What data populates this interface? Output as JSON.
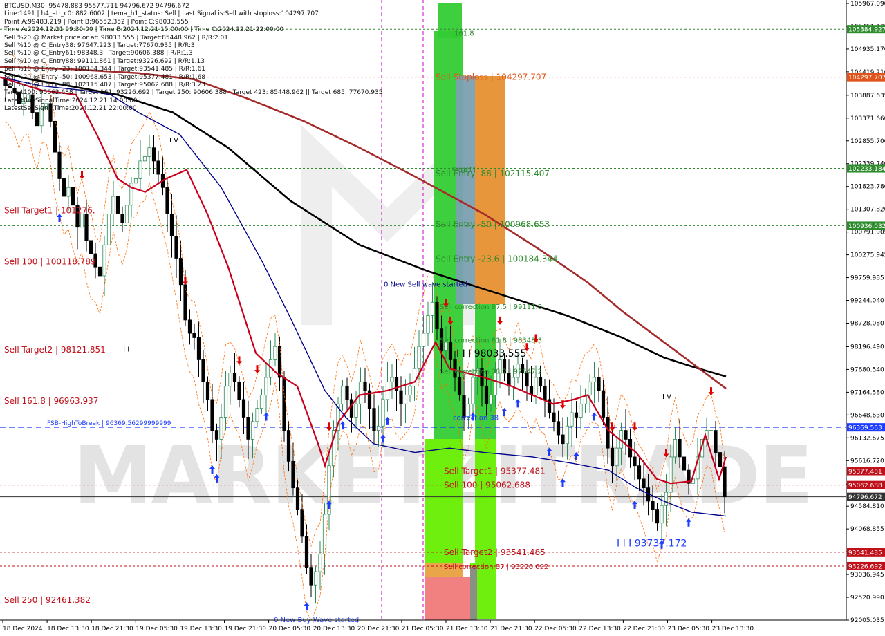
{
  "window": {
    "title": "BTCUSD,M30"
  },
  "info_lines": [
    "BTCUSD,M30  95478.883 95577.711 94796.672 94796.672",
    "Line:1491 | h4_atr_c0: 882.6002 | tema_h1_status: Sell | Last Signal is:Sell with stoploss:104297.707",
    "Point A:99483.219 | Point B:96552.352 | Point C:98033.555",
    "Time A:2024.12.21 09:30:00 | Time B:2024.12.21 15:00:00 | Time C:2024.12.21 22:00:00",
    "Sell %20 @ Market price or at: 98033.555 | Target:85448.962 | R/R:2.01",
    "Sell %10 @ C_Entry38: 97647.223 | Target:77670.935 | R/R:3",
    "Sell %10 @ C_Entry61: 98348.3 | Target:90606.388 | R/R:1.3",
    "Sell %10 @ C_Entry88: 99111.861 | Target:93226.692 | R/R:1.13",
    "Sell %10 @ Entry -23: 100184.344 | Target:93541.485 | R/R:1.61",
    "Sell %20 @ Entry -50: 100968.653 | Target:95377.481 | R/R:1.68",
    "Sell %20 @ Entry -88: 102115.407 | Target:95062.688 | R/R:3.23",
    "Target100: 95062.688 | Target 161: 93226.692 | Target 250: 90606.388 | Target 423: 85448.962 || Target 685: 77670.935",
    "LatestBuySignalTime:2024.12.21 14:00:00",
    "LatestSellSignalTime:2024.12.21 22:00:00"
  ],
  "chart_data": {
    "type": "candlestick",
    "symbol": "BTCUSD",
    "timeframe": "M30",
    "ylim": [
      92005.035,
      105967.09
    ],
    "y_ticks": [
      "105967.090",
      "105451.130",
      "104935.170",
      "104419.210",
      "103887.635",
      "103371.660",
      "102855.700",
      "102339.740",
      "101823.780",
      "101307.820",
      "100791.905",
      "100275.945",
      "99759.985",
      "99244.040",
      "98728.080",
      "98196.490",
      "97680.540",
      "97164.580",
      "96648.630",
      "96132.675",
      "95616.720",
      "95084.780",
      "94584.810",
      "94068.855",
      "93552.900",
      "93036.945",
      "92520.990",
      "92005.035"
    ],
    "x_ticks": [
      "18 Dec 2024",
      "18 Dec 13:30",
      "18 Dec 21:30",
      "19 Dec 05:30",
      "19 Dec 13:30",
      "19 Dec 21:30",
      "20 Dec 05:30",
      "20 Dec 13:30",
      "20 Dec 21:30",
      "21 Dec 05:30",
      "21 Dec 13:30",
      "21 Dec 21:30",
      "22 Dec 05:30",
      "22 Dec 13:30",
      "22 Dec 21:30",
      "23 Dec 05:30",
      "23 Dec 13:30"
    ],
    "close": [
      104100,
      104050,
      103950,
      103700,
      103750,
      103900,
      103500,
      103200,
      103600,
      103700,
      103300,
      102600,
      102000,
      101600,
      101800,
      101400,
      100900,
      101200,
      100600,
      100300,
      100000,
      99800,
      100500,
      101200,
      101600,
      101200,
      101000,
      101400,
      101900,
      102000,
      102400,
      102500,
      102700,
      102400,
      102100,
      101800,
      101200,
      100700,
      100200,
      99600,
      98800,
      98500,
      98400,
      97900,
      97400,
      97000,
      96300,
      96100,
      96600,
      97300,
      97600,
      97400,
      97000,
      96600,
      96100,
      96500,
      96800,
      97100,
      97500,
      97900,
      98200,
      97500,
      96300,
      95600,
      95000,
      94500,
      93900,
      93200,
      92800,
      93100,
      93500,
      94400,
      95500,
      96300,
      96900,
      97300,
      97000,
      96600,
      96900,
      97400,
      97200,
      96800,
      96300,
      96400,
      97000,
      97400,
      97500,
      97200,
      96900,
      97100,
      97300,
      97700,
      98200,
      98500,
      98900,
      99200,
      98600,
      98100,
      98300,
      97900,
      97500,
      97100,
      96600,
      96900,
      97500,
      97700,
      97300,
      96900,
      97100,
      97600,
      97900,
      97600,
      97300,
      97500,
      97800,
      97600,
      97300,
      97100,
      97500,
      97300,
      97000,
      96700,
      96500,
      96200,
      96000,
      96400,
      96700,
      96600,
      96900,
      97100,
      97400,
      97500,
      97200,
      96600,
      95900,
      95500,
      95900,
      96300,
      96100,
      95700,
      95500,
      95200,
      95000,
      94700,
      94500,
      94200,
      94600,
      94900,
      95700,
      96100,
      95700,
      95400,
      95100,
      95200,
      95700,
      96100,
      96300,
      96300,
      95800,
      95478,
      94796
    ],
    "overlay_lines": [
      {
        "name": "ma-black",
        "color": "#000000",
        "values": [
          [
            0,
            104420
          ],
          [
            40,
            104260
          ],
          [
            100,
            104100
          ],
          [
            170,
            103900
          ],
          [
            250,
            103500
          ],
          [
            330,
            102700
          ],
          [
            420,
            101500
          ],
          [
            520,
            100500
          ],
          [
            620,
            99900
          ],
          [
            720,
            99400
          ],
          [
            820,
            98900
          ],
          [
            900,
            98400
          ],
          [
            960,
            97950
          ],
          [
            1000,
            97750
          ],
          [
            1050,
            97520
          ]
        ]
      },
      {
        "name": "ma-brown",
        "color": "#a52a2a",
        "values": [
          [
            0,
            104530
          ],
          [
            100,
            104480
          ],
          [
            200,
            104390
          ],
          [
            280,
            104250
          ],
          [
            360,
            103800
          ],
          [
            440,
            103300
          ],
          [
            520,
            102700
          ],
          [
            600,
            102050
          ],
          [
            700,
            101200
          ],
          [
            780,
            100400
          ],
          [
            850,
            99650
          ],
          [
            900,
            99000
          ],
          [
            960,
            98300
          ],
          [
            1050,
            97250
          ]
        ]
      },
      {
        "name": "ma-navy",
        "color": "#00008b",
        "values": [
          [
            0,
            104300
          ],
          [
            60,
            104100
          ],
          [
            120,
            104000
          ],
          [
            160,
            103900
          ],
          [
            200,
            103500
          ],
          [
            260,
            103000
          ],
          [
            320,
            101800
          ],
          [
            380,
            100100
          ],
          [
            420,
            98850
          ],
          [
            470,
            97200
          ],
          [
            500,
            96600
          ],
          [
            540,
            96000
          ],
          [
            600,
            95800
          ],
          [
            650,
            95900
          ],
          [
            700,
            95800
          ],
          [
            770,
            95700
          ],
          [
            830,
            95550
          ],
          [
            880,
            95400
          ],
          [
            920,
            95000
          ],
          [
            960,
            94700
          ],
          [
            1000,
            94450
          ],
          [
            1050,
            94360
          ]
        ]
      },
      {
        "name": "tema-red",
        "color": "#c8001e",
        "values": [
          [
            0,
            104300
          ],
          [
            60,
            104000
          ],
          [
            110,
            103900
          ],
          [
            140,
            103000
          ],
          [
            170,
            102000
          ],
          [
            190,
            101800
          ],
          [
            210,
            101700
          ],
          [
            240,
            102000
          ],
          [
            270,
            102200
          ],
          [
            300,
            101200
          ],
          [
            330,
            100000
          ],
          [
            370,
            98050
          ],
          [
            400,
            97600
          ],
          [
            430,
            97300
          ],
          [
            460,
            96000
          ],
          [
            470,
            95500
          ],
          [
            490,
            96500
          ],
          [
            520,
            97100
          ],
          [
            560,
            97200
          ],
          [
            600,
            97400
          ],
          [
            630,
            98300
          ],
          [
            650,
            97700
          ],
          [
            700,
            97500
          ],
          [
            740,
            97300
          ],
          [
            770,
            97100
          ],
          [
            800,
            96900
          ],
          [
            830,
            97000
          ],
          [
            850,
            97100
          ],
          [
            880,
            96300
          ],
          [
            920,
            95800
          ],
          [
            950,
            95200
          ],
          [
            970,
            95100
          ],
          [
            1000,
            95150
          ],
          [
            1020,
            96200
          ],
          [
            1040,
            95200
          ],
          [
            1050,
            95700
          ]
        ]
      }
    ],
    "levels": [
      {
        "price": 105384.927,
        "label": "105384.927",
        "color": "#2e8b2e",
        "style": "dotted"
      },
      {
        "price": 104297.707,
        "label": "104297.707",
        "color": "#e0531a",
        "style": "dotted"
      },
      {
        "price": 102233.184,
        "label": "102233.184",
        "color": "#2e8b2e",
        "style": "dotted"
      },
      {
        "price": 100936.032,
        "label": "100936.032",
        "color": "#2e8b2e",
        "style": "dotted"
      },
      {
        "price": 96369.563,
        "label": "96369.563",
        "color": "#1c3cff",
        "style": "dashed"
      },
      {
        "price": 95377.481,
        "label": "95377.481",
        "color": "#c0101a",
        "style": "dotted"
      },
      {
        "price": 95062.688,
        "label": "95062.688",
        "color": "#c0101a",
        "style": "dotted"
      },
      {
        "price": 94796.672,
        "label": "94796.672",
        "color": "#333333",
        "style": "solid"
      },
      {
        "price": 93541.485,
        "label": "93541.485",
        "color": "#c0101a",
        "style": "dotted"
      },
      {
        "price": 93226.692,
        "label": "93226.692",
        "color": "#c0101a",
        "style": "dotted"
      }
    ],
    "left_labels": [
      {
        "text": "Sell Target1 | 101276.",
        "price": 101276,
        "color": "#c0101a"
      },
      {
        "text": "Sell 100 | 100118.789",
        "price": 100118.789,
        "color": "#c0101a"
      },
      {
        "text": "Sell Target2 | 98121.851",
        "price": 98121.851,
        "color": "#c0101a"
      },
      {
        "text": "Sell 161.8 | 96963.937",
        "price": 96963.937,
        "color": "#c0101a"
      },
      {
        "text": "FSB-HighToBreak | 96369.56299999999",
        "price": 96369.563,
        "color": "#1c3cff"
      },
      {
        "text": "Sell 250 | 92461.382",
        "price": 92461.382,
        "color": "#c0101a"
      }
    ],
    "zone_labels": [
      {
        "text": "161.8",
        "price": 105300,
        "color": "#2e8b2e"
      },
      {
        "text": "Sell Stoploss | 104297.707",
        "price": 104297.707,
        "color": "#e0531a"
      },
      {
        "text": "Target1",
        "price": 102230,
        "color": "#2e8b2e"
      },
      {
        "text": "Sell Entry -88 | 102115.407",
        "price": 102115.407,
        "color": "#2e8b2e"
      },
      {
        "text": "Sell Entry -50 | 100968.653",
        "price": 100968.653,
        "color": "#2e8b2e"
      },
      {
        "text": "Sell Entry -23.6 | 100184.344",
        "price": 100184.344,
        "color": "#2e8b2e"
      },
      {
        "text": "0 New Sell wave started",
        "price": 99620,
        "color": "#000080"
      },
      {
        "text": "Sell correction 87.5 | 99111.8",
        "price": 99111.8,
        "color": "#2e8b2e"
      },
      {
        "text": "I I I  98033.555",
        "price": 98033.555,
        "color": "#000000"
      },
      {
        "text": "Sell correction 61.8 | 98348.3",
        "price": 98348.3,
        "color": "#2e8b2e"
      },
      {
        "text": "Sell correction 38.2 | 97647.2",
        "price": 97647.2,
        "color": "#2e8b2e"
      },
      {
        "text": "correction 38",
        "price": 96600,
        "color": "#1c3cff"
      },
      {
        "text": "Sell Target1 | 95377.481",
        "price": 95377.481,
        "color": "#c0101a"
      },
      {
        "text": "Sell 100 | 95062.688",
        "price": 95062.688,
        "color": "#c0101a"
      },
      {
        "text": "Sell Target2 | 93541.485",
        "price": 93541.485,
        "color": "#c0101a"
      },
      {
        "text": "Sell correction 87 | 93226.692",
        "price": 93226.692,
        "color": "#c0101a"
      },
      {
        "text": "I I I  93737.172",
        "price": 93737.172,
        "color": "#1c3cff"
      },
      {
        "text": "0 New Buy Wave started",
        "price": 92020,
        "color": "#1c3cff"
      },
      {
        "text": "I V",
        "price": 102880,
        "color": "#000000"
      },
      {
        "text": "I V",
        "price": 97080,
        "color": "#000000"
      },
      {
        "text": "I I I",
        "price": 98150,
        "color": "#000000"
      }
    ],
    "watermark": "MARKETZITRADE",
    "colors": {
      "up": "#2e8b57",
      "down": "#000000",
      "zone_green": "#33cc33",
      "zone_lime": "#66ee00",
      "zone_orange": "#e69030",
      "zone_salmon": "#f07a7a",
      "zone_gray": "#8a8a8a"
    }
  }
}
